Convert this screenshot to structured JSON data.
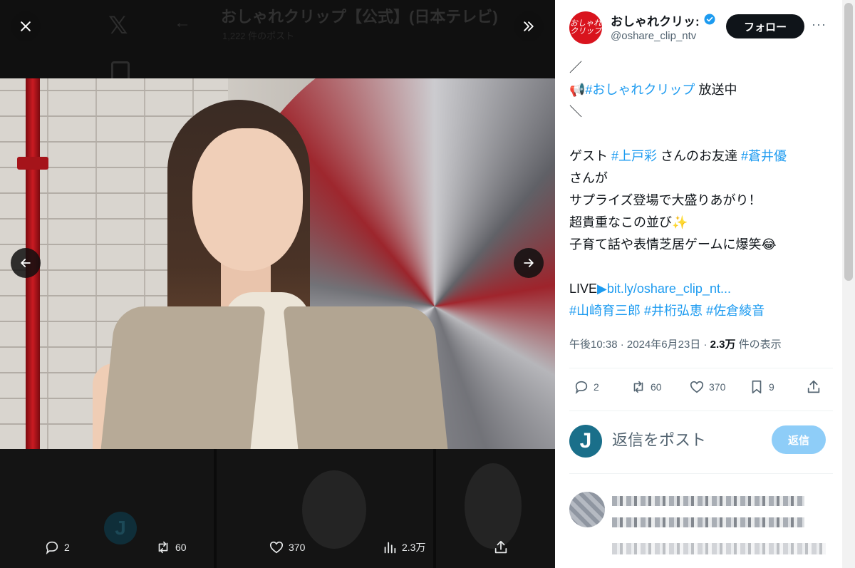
{
  "viewer": {
    "background_title": "おしゃれクリップ【公式】(日本テレビ)",
    "background_subtitle": "1,222 件のポスト",
    "actions": {
      "reply_count": "2",
      "repost_count": "60",
      "like_count": "370",
      "views_count": "2.3万"
    }
  },
  "tweet": {
    "author_name": "おしゃれクリッ:",
    "author_avatar_text": "おしゃれクリップ",
    "handle": "@oshare_clip_ntv",
    "follow_label": "フォロー",
    "more_label": "···",
    "lines": {
      "l1": "／",
      "l2_emoji": "📢",
      "l2_tag": "#おしゃれクリップ",
      "l2_text": " 放送中",
      "l3": "＼",
      "l4_a": "ゲスト ",
      "l4_tag1": "#上戸彩",
      "l4_b": " さんのお友達 ",
      "l4_tag2": "#蒼井優",
      "l5": "さんが",
      "l6": "サプライズ登場で大盛りあがり！",
      "l7_text": "超貴重なこの並び",
      "l7_emoji": "✨",
      "l8_text": "子育て話や表情芝居ゲームに爆笑",
      "l8_emoji": "😂",
      "l9_text": "LIVE",
      "l9_emoji": "▶",
      "l9_link": "bit.ly/oshare_clip_nt...",
      "l10_tag1": "#山崎育三郎",
      "l10_tag2": "#井桁弘恵",
      "l10_tag3": "#佐倉綾音"
    },
    "meta": {
      "time": "午後10:38",
      "sep": " · ",
      "date": "2024年6月23日",
      "views_value": "2.3万",
      "views_label": " 件の表示"
    },
    "stats": {
      "reply": "2",
      "repost": "60",
      "like": "370",
      "bookmark": "9"
    }
  },
  "reply_box": {
    "avatar_letter": "J",
    "placeholder": "返信をポスト",
    "button_label": "返信"
  },
  "colors": {
    "accent": "#1d9bf0",
    "follow_button": "#0f1419",
    "reply_button_disabled": "#8ecdf8",
    "brand_red": "#d9141e"
  }
}
